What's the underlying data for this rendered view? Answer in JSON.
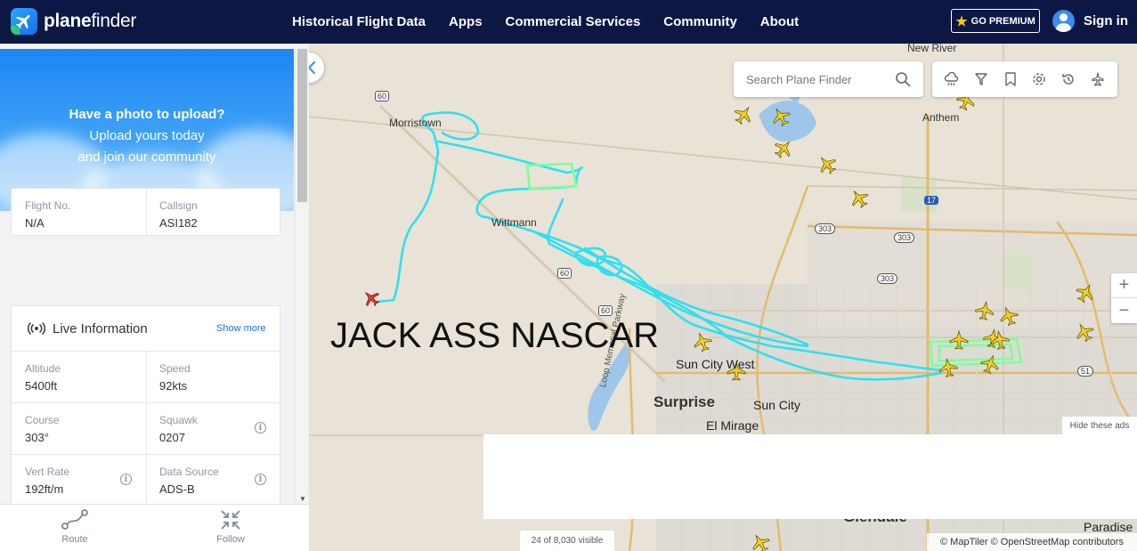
{
  "header": {
    "logo": "planefinder",
    "nav": [
      "Historical Flight Data",
      "Apps",
      "Commercial Services",
      "Community",
      "About"
    ],
    "premium_label": "GO PREMIUM",
    "signin_label": "Sign in"
  },
  "sidebar": {
    "banner": {
      "line1": "Have a photo to upload?",
      "line2": "Upload yours today",
      "line3": "and join our community"
    },
    "flight": {
      "flight_no_label": "Flight No.",
      "flight_no_value": "N/A",
      "callsign_label": "Callsign",
      "callsign_value": "ASI182"
    },
    "live": {
      "title": "Live Information",
      "show_more": "Show more",
      "altitude_label": "Altitude",
      "altitude_value": "5400ft",
      "speed_label": "Speed",
      "speed_value": "92kts",
      "course_label": "Course",
      "course_value": "303°",
      "squawk_label": "Squawk",
      "squawk_value": "0207",
      "vert_rate_label": "Vert Rate",
      "vert_rate_value": "192ft/m",
      "data_source_label": "Data Source",
      "data_source_value": "ADS-B"
    },
    "tabs": {
      "route": "Route",
      "follow": "Follow"
    }
  },
  "map": {
    "search_placeholder": "Search Plane Finder",
    "overlay_text": "JACK ASS NASCAR",
    "labels": {
      "new_river": "New River",
      "anthem": "Anthem",
      "morristown": "Morristown",
      "wittmann": "Wittmann",
      "sun_city_west": "Sun City West",
      "surprise": "Surprise",
      "sun_city": "Sun City",
      "el_mirage": "El Mirage",
      "glendale": "Glendale",
      "paradise": "Paradise",
      "parkway": "Loop Memorial Parkway"
    },
    "shields": {
      "us60a": "60",
      "us60b": "60",
      "us60c": "60",
      "i17": "17",
      "r303a": "303",
      "r303b": "303",
      "r303c": "303",
      "r51": "51"
    },
    "hide_ads": "Hide these ads",
    "visible_count": "24 of 8,030 visible",
    "attribution": "© MapTiler © OpenStreetMap contributors",
    "track_colors": {
      "cyan": "#2ee0f0",
      "green": "#7dff9a",
      "selected_plane": "#d83a2e",
      "plane": "#f3d21c"
    }
  }
}
